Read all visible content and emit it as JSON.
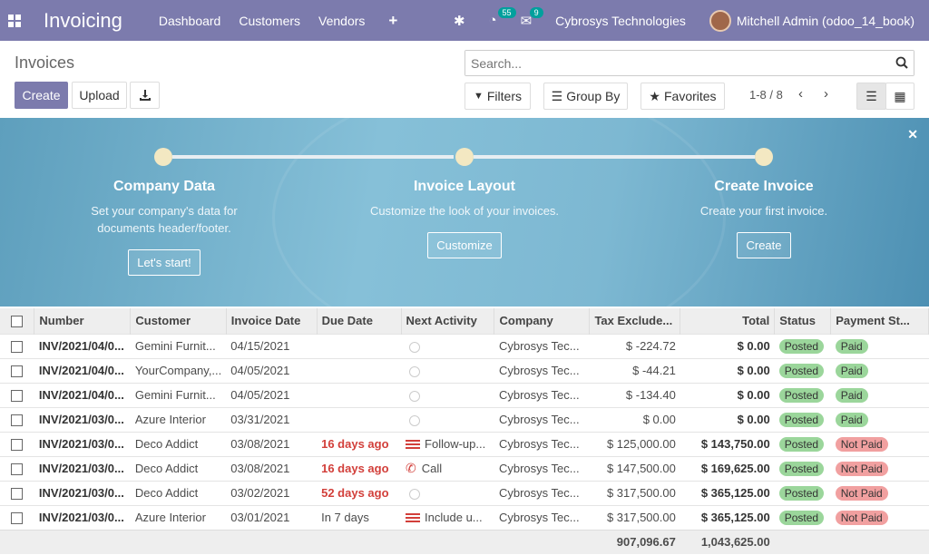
{
  "topbar": {
    "app_name": "Invoicing",
    "menus": [
      "Dashboard",
      "Customers",
      "Vendors"
    ],
    "plus": "+",
    "activity_badge": "55",
    "message_badge": "9",
    "company": "Cybrosys Technologies",
    "user": "Mitchell Admin (odoo_14_book)"
  },
  "page": {
    "title": "Invoices",
    "create": "Create",
    "upload": "Upload",
    "search_placeholder": "Search...",
    "filters": "Filters",
    "groupby": "Group By",
    "favorites": "Favorites",
    "pager": "1-8 / 8"
  },
  "banner": {
    "steps": [
      {
        "title": "Company Data",
        "desc": "Set your company's data for documents header/footer.",
        "button": "Let's start!"
      },
      {
        "title": "Invoice Layout",
        "desc": "Customize the look of your invoices.",
        "button": "Customize"
      },
      {
        "title": "Create Invoice",
        "desc": "Create your first invoice.",
        "button": "Create"
      }
    ]
  },
  "table": {
    "columns": [
      "Number",
      "Customer",
      "Invoice Date",
      "Due Date",
      "Next Activity",
      "Company",
      "Tax Exclude...",
      "Total",
      "Status",
      "Payment St..."
    ],
    "rows": [
      {
        "number": "INV/2021/04/0...",
        "customer": "Gemini Furnit...",
        "date": "04/15/2021",
        "due": "",
        "activity": "",
        "company": "Cybrosys Tec...",
        "tax": "$ -224.72",
        "total": "$ 0.00",
        "status": "Posted",
        "payment": "Paid"
      },
      {
        "number": "INV/2021/04/0...",
        "customer": "YourCompany,...",
        "date": "04/05/2021",
        "due": "",
        "activity": "",
        "company": "Cybrosys Tec...",
        "tax": "$ -44.21",
        "total": "$ 0.00",
        "status": "Posted",
        "payment": "Paid"
      },
      {
        "number": "INV/2021/04/0...",
        "customer": "Gemini Furnit...",
        "date": "04/05/2021",
        "due": "",
        "activity": "",
        "company": "Cybrosys Tec...",
        "tax": "$ -134.40",
        "total": "$ 0.00",
        "status": "Posted",
        "payment": "Paid"
      },
      {
        "number": "INV/2021/03/0...",
        "customer": "Azure Interior",
        "date": "03/31/2021",
        "due": "",
        "activity": "",
        "company": "Cybrosys Tec...",
        "tax": "$ 0.00",
        "total": "$ 0.00",
        "status": "Posted",
        "payment": "Paid"
      },
      {
        "number": "INV/2021/03/0...",
        "customer": "Deco Addict",
        "date": "03/08/2021",
        "due": "16 days ago",
        "activity": "Follow-up...",
        "company": "Cybrosys Tec...",
        "tax": "$ 125,000.00",
        "total": "$ 143,750.00",
        "status": "Posted",
        "payment": "Not Paid"
      },
      {
        "number": "INV/2021/03/0...",
        "customer": "Deco Addict",
        "date": "03/08/2021",
        "due": "16 days ago",
        "activity": "Call",
        "company": "Cybrosys Tec...",
        "tax": "$ 147,500.00",
        "total": "$ 169,625.00",
        "status": "Posted",
        "payment": "Not Paid"
      },
      {
        "number": "INV/2021/03/0...",
        "customer": "Deco Addict",
        "date": "03/02/2021",
        "due": "52 days ago",
        "activity": "",
        "company": "Cybrosys Tec...",
        "tax": "$ 317,500.00",
        "total": "$ 365,125.00",
        "status": "Posted",
        "payment": "Not Paid"
      },
      {
        "number": "INV/2021/03/0...",
        "customer": "Azure Interior",
        "date": "03/01/2021",
        "due": "In 7 days",
        "activity": "Include u...",
        "company": "Cybrosys Tec...",
        "tax": "$ 317,500.00",
        "total": "$ 365,125.00",
        "status": "Posted",
        "payment": "Not Paid"
      }
    ],
    "footer": {
      "tax_total": "907,096.67",
      "total": "1,043,625.00"
    }
  }
}
